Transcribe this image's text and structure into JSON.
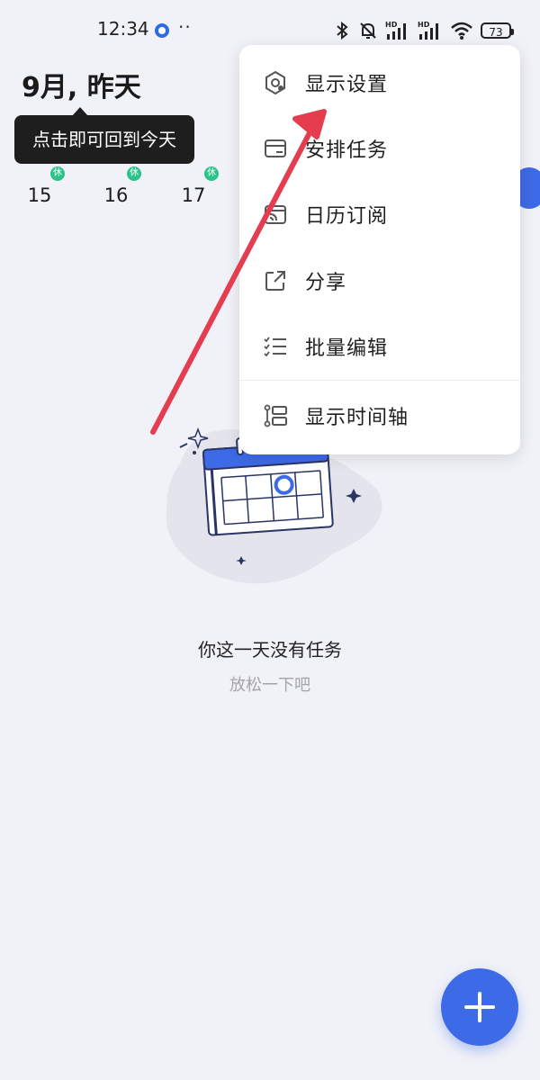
{
  "status_bar": {
    "time": "12:34",
    "battery": "73",
    "icons": [
      "app-notification-icon",
      "more-dots-icon",
      "bluetooth-icon",
      "bell-muted-icon",
      "signal-hd-icon",
      "signal-hd-icon",
      "wifi-icon",
      "battery-icon"
    ]
  },
  "header": {
    "title": "9月, 昨天",
    "tooltip": "点击即可回到今天"
  },
  "week": {
    "days": [
      {
        "num": "15",
        "badge": "休"
      },
      {
        "num": "16",
        "badge": "休"
      },
      {
        "num": "17",
        "badge": "休"
      }
    ]
  },
  "empty_state": {
    "title": "你这一天没有任务",
    "subtitle": "放松一下吧"
  },
  "menu": {
    "items": [
      {
        "label": "显示设置",
        "icon": "gear-hex-icon"
      },
      {
        "label": "安排任务",
        "icon": "schedule-card-icon"
      },
      {
        "label": "日历订阅",
        "icon": "calendar-subscribe-icon"
      },
      {
        "label": "分享",
        "icon": "share-icon"
      },
      {
        "label": "批量编辑",
        "icon": "batch-edit-checklist-icon"
      },
      {
        "label": "显示时间轴",
        "icon": "timeline-icon"
      }
    ]
  },
  "fab": {
    "icon": "plus-icon"
  },
  "colors": {
    "accent": "#3d6ae6",
    "holiday": "#29c48a",
    "annotation_arrow": "#e43d4f",
    "background": "#f1f2f8"
  }
}
